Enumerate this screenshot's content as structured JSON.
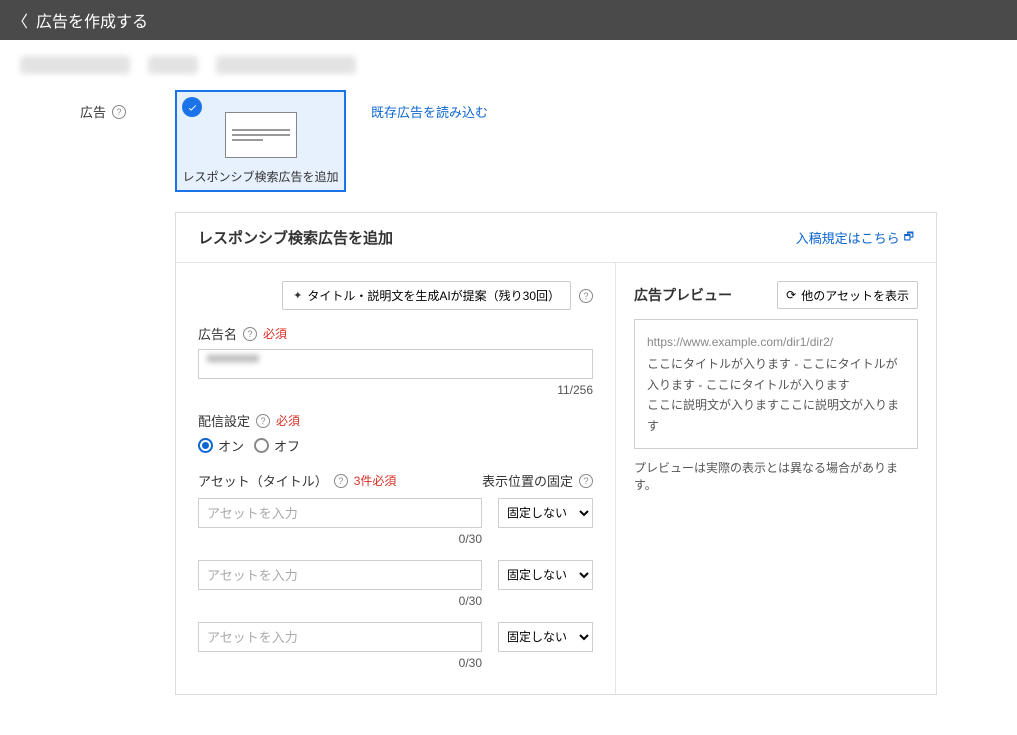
{
  "header": {
    "title": "広告を作成する"
  },
  "side": {
    "label": "広告"
  },
  "ad_type_card": {
    "label": "レスポンシブ検索広告を追加"
  },
  "links": {
    "load_existing": "既存広告を読み込む",
    "guide": "入稿規定はこちら"
  },
  "panel": {
    "title": "レスポンシブ検索広告を追加"
  },
  "ai": {
    "button_label": "タイトル・説明文を生成AIが提案（残り30回）"
  },
  "ad_name": {
    "label": "広告名",
    "required": "必須",
    "counter": "11/256"
  },
  "delivery": {
    "label": "配信設定",
    "required": "必須",
    "on": "オン",
    "off": "オフ"
  },
  "assets": {
    "label": "アセット（タイトル）",
    "required": "3件必須",
    "pin_label": "表示位置の固定",
    "placeholder": "アセットを入力",
    "pin_options": [
      "固定しない"
    ],
    "rows": [
      {
        "counter": "0/30"
      },
      {
        "counter": "0/30"
      },
      {
        "counter": "0/30"
      }
    ]
  },
  "preview": {
    "title": "広告プレビュー",
    "refresh": "他のアセットを表示",
    "url": "https://www.example.com/dir1/dir2/",
    "titles": "ここにタイトルが入ります - ここにタイトルが入ります - ここにタイトルが入ります",
    "desc": "ここに説明文が入りますここに説明文が入ります",
    "note": "プレビューは実際の表示とは異なる場合があります。"
  }
}
